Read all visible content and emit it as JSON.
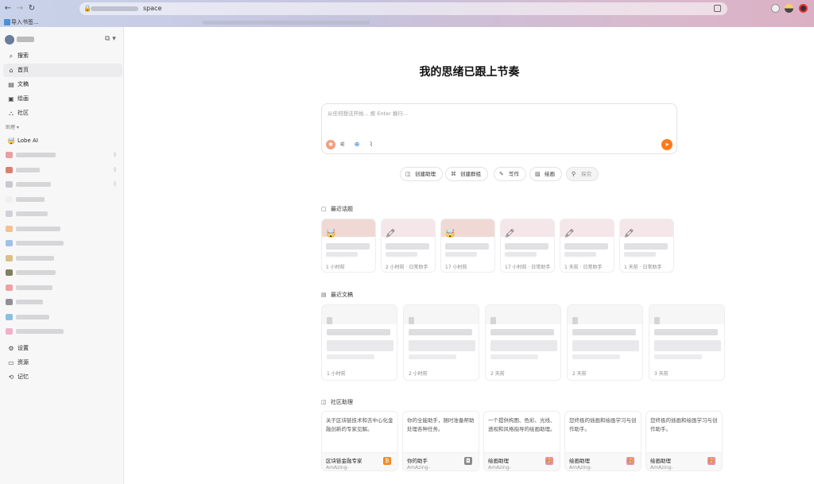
{
  "browser": {
    "url_visible": "space",
    "bookmark_label": "导入书签..."
  },
  "sidebar": {
    "nav_top": [
      {
        "icon": "search-icon",
        "glyph": "⌕",
        "label": "搜索"
      },
      {
        "icon": "home-icon",
        "glyph": "⌂",
        "label": "首页"
      },
      {
        "icon": "document-icon",
        "glyph": "▤",
        "label": "文稿"
      },
      {
        "icon": "image-icon",
        "glyph": "▣",
        "label": "绘画"
      },
      {
        "icon": "community-icon",
        "glyph": "⛬",
        "label": "社区"
      }
    ],
    "section_label": "助理 ▾",
    "lobe_agent": {
      "emoji": "🤯",
      "label": "Lobe AI"
    },
    "nav_bottom": [
      {
        "icon": "gear-icon",
        "glyph": "⚙",
        "label": "设置"
      },
      {
        "icon": "resource-icon",
        "glyph": "▭",
        "label": "资源"
      },
      {
        "icon": "memory-icon",
        "glyph": "⟲",
        "label": "记忆"
      }
    ]
  },
  "main": {
    "hero_title": "我的思绪已跟上节奏",
    "input": {
      "placeholder": "从任何想法开始... 按 Enter 换行..."
    },
    "actions": [
      {
        "icon": "robot-icon",
        "glyph": "◫",
        "label": "创建助理"
      },
      {
        "icon": "group-icon",
        "glyph": "⌘",
        "label": "创建群组"
      },
      {
        "icon": "write-icon",
        "glyph": "✎",
        "label": "写作"
      },
      {
        "icon": "paint-icon",
        "glyph": "▨",
        "label": "绘画"
      },
      {
        "icon": "research-icon",
        "glyph": "⚲",
        "label": "探究"
      }
    ],
    "recent_topics_title": "最近话题",
    "recent_topics": [
      {
        "emoji": "🤯",
        "time": "1 小时前",
        "color": "#f0d9d5"
      },
      {
        "emoji": "🖍",
        "time": "2 小时前 · 日常助手",
        "color": "#f5e6ea"
      },
      {
        "emoji": "🤯",
        "time": "17 小时前",
        "color": "#f0d9d5"
      },
      {
        "emoji": "🖍",
        "time": "17 小时前 · 日常助手",
        "color": "#f5e6ea"
      },
      {
        "emoji": "🖍",
        "time": "1 天前 · 日常助手",
        "color": "#f5e6ea"
      },
      {
        "emoji": "🖍",
        "time": "1 天前 · 日常助手",
        "color": "#f5e6ea"
      }
    ],
    "recent_docs_title": "最近文稿",
    "recent_docs": [
      {
        "time": "1 小时前"
      },
      {
        "time": "2 小时前"
      },
      {
        "time": "2 天前"
      },
      {
        "time": "2 天前"
      },
      {
        "time": "3 天前"
      }
    ],
    "community_title": "社区助理",
    "community": [
      {
        "desc": "关于区块链技术和去中心化金融创新的专家见解。",
        "name": "区块链金融专家",
        "author": "AmAzing-",
        "icon_color": "#f08a24",
        "glyph": "₿"
      },
      {
        "desc": "你的全能助手，随时准备帮助处理各种任务。",
        "name": "你的助手",
        "author": "AmAzing-",
        "icon_color": "#8a8a8a",
        "glyph": "◘"
      },
      {
        "desc": "一个提供构图、色彩、光线、透视和风格指导的绘画助理。",
        "name": "绘画助理",
        "author": "AmAzing-",
        "icon_color": "#e88fa6",
        "glyph": "🎨"
      },
      {
        "desc": "您终极的插画和绘画学习与创作助手。",
        "name": "绘画助理",
        "author": "AmAzing-",
        "icon_color": "#e88fa6",
        "glyph": "🎨"
      },
      {
        "desc": "您终极的插画和绘画学习与创作助手。",
        "name": "绘画助理",
        "author": "AmAzing-",
        "icon_color": "#e88fa6",
        "glyph": "🎨"
      }
    ]
  }
}
